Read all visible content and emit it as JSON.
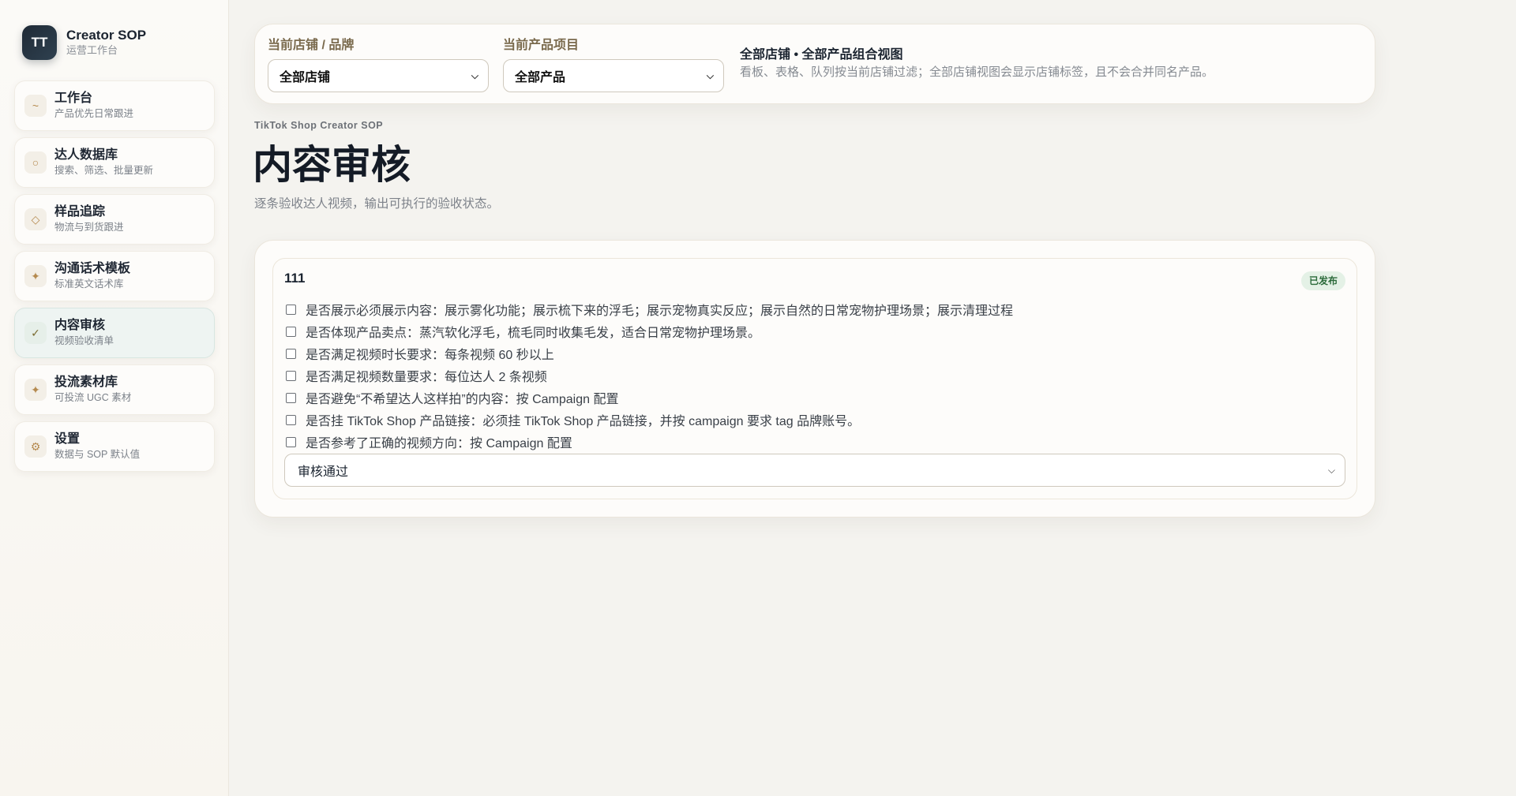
{
  "brand": {
    "logo": "TT",
    "title": "Creator SOP",
    "subtitle": "运营工作台"
  },
  "sidebar": {
    "items": [
      {
        "icon": "~",
        "icon_name": "trend-icon",
        "label": "工作台",
        "sub": "产品优先日常跟进"
      },
      {
        "icon": "○",
        "icon_name": "circle-icon",
        "label": "达人数据库",
        "sub": "搜索、筛选、批量更新"
      },
      {
        "icon": "◇",
        "icon_name": "diamond-icon",
        "label": "样品追踪",
        "sub": "物流与到货跟进"
      },
      {
        "icon": "✦",
        "icon_name": "sparkle-icon",
        "label": "沟通话术模板",
        "sub": "标准英文话术库"
      },
      {
        "icon": "✓",
        "icon_name": "check-icon",
        "label": "内容审核",
        "sub": "视频验收清单",
        "active": true
      },
      {
        "icon": "✦",
        "icon_name": "star-icon",
        "label": "投流素材库",
        "sub": "可投流 UGC 素材"
      },
      {
        "icon": "⚙",
        "icon_name": "gear-icon",
        "label": "设置",
        "sub": "数据与 SOP 默认值"
      }
    ]
  },
  "filters": {
    "store_label": "当前店铺 / 品牌",
    "store_value": "全部店铺",
    "product_label": "当前产品项目",
    "product_value": "全部产品",
    "info_title": "全部店铺 • 全部产品组合视图",
    "info_desc": "看板、表格、队列按当前店铺过滤；全部店铺视图会显示店铺标签，且不会合并同名产品。"
  },
  "header": {
    "eyebrow": "TikTok Shop Creator SOP",
    "title": "内容审核",
    "description": "逐条验收达人视频，输出可执行的验收状态。"
  },
  "review": {
    "title": "111",
    "status": "已发布",
    "checklist": [
      "是否展示必须展示内容：展示雾化功能；展示梳下来的浮毛；展示宠物真实反应；展示自然的日常宠物护理场景；展示清理过程",
      "是否体现产品卖点：蒸汽软化浮毛，梳毛同时收集毛发，适合日常宠物护理场景。",
      "是否满足视频时长要求：每条视频 60 秒以上",
      "是否满足视频数量要求：每位达人 2 条视频",
      "是否避免“不希望达人这样拍”的内容：按 Campaign 配置",
      "是否挂 TikTok Shop 产品链接：必须挂 TikTok Shop 产品链接，并按 campaign 要求 tag 品牌账号。",
      "是否参考了正确的视频方向：按 Campaign 配置"
    ],
    "result_value": "审核通过"
  }
}
